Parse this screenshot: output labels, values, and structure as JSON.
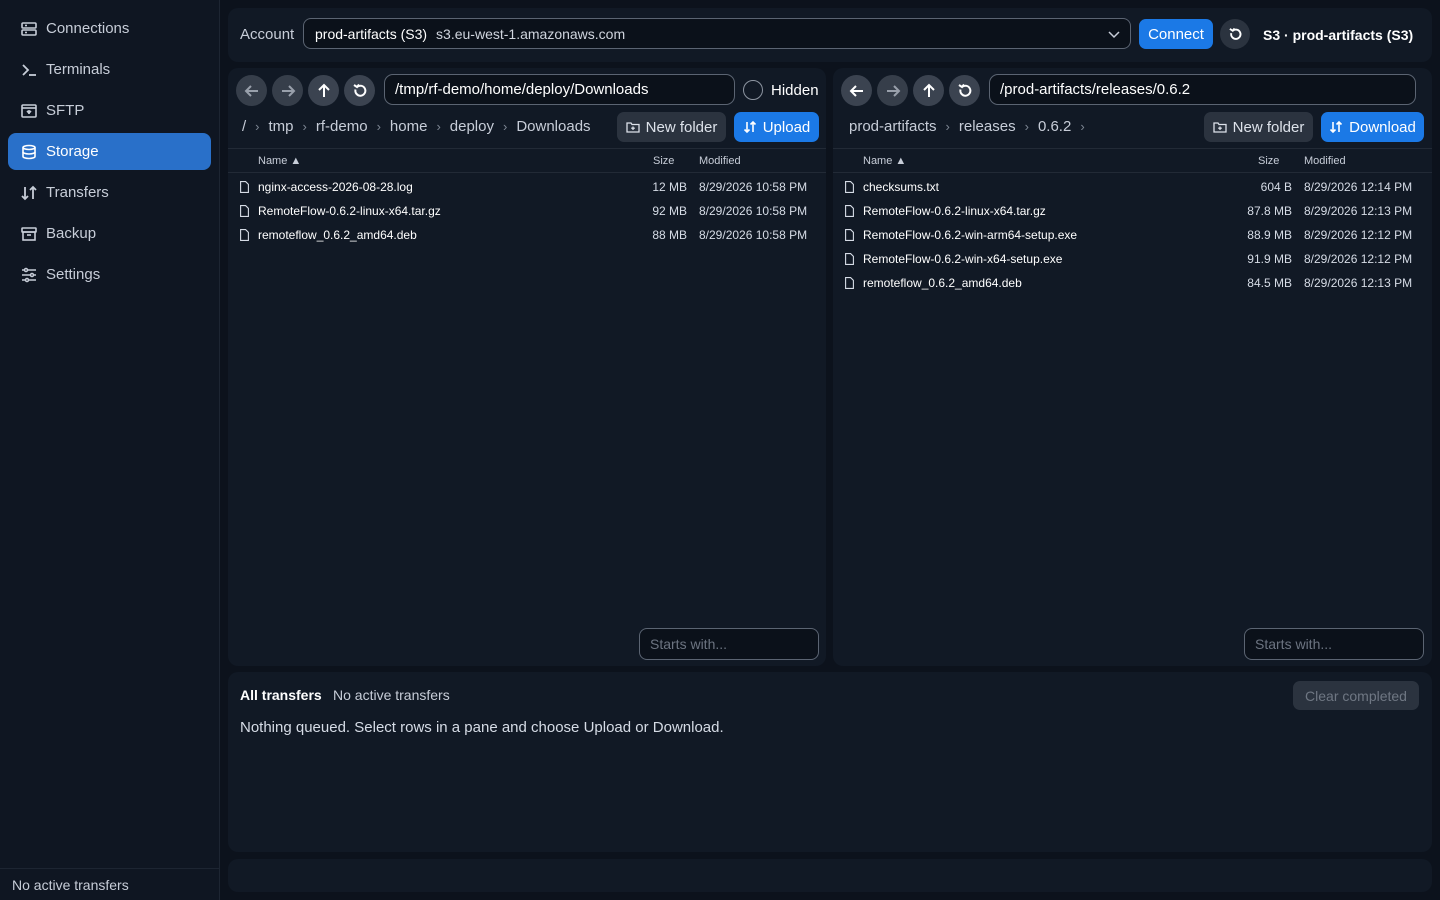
{
  "sidebar": {
    "items": [
      {
        "label": "Connections",
        "icon": "server-icon"
      },
      {
        "label": "Terminals",
        "icon": "terminal-icon"
      },
      {
        "label": "SFTP",
        "icon": "sftp-icon"
      },
      {
        "label": "Storage",
        "icon": "database-icon",
        "active": true
      },
      {
        "label": "Transfers",
        "icon": "transfer-arrows-icon"
      },
      {
        "label": "Backup",
        "icon": "archive-icon"
      },
      {
        "label": "Settings",
        "icon": "sliders-icon"
      }
    ],
    "footer": "No active transfers"
  },
  "topbar": {
    "account_label": "Account",
    "account_name": "prod-artifacts (S3)",
    "account_endpoint": "s3.eu-west-1.amazonaws.com",
    "connect_label": "Connect",
    "connection_title": "S3 · prod-artifacts (S3)"
  },
  "left_pane": {
    "path": "/tmp/rf-demo/home/deploy/Downloads",
    "hidden_label": "Hidden",
    "breadcrumbs": [
      "/",
      "tmp",
      "rf-demo",
      "home",
      "deploy",
      "Downloads"
    ],
    "new_folder_label": "New folder",
    "action_label": "Upload",
    "columns": {
      "name": "Name ▲",
      "size": "Size",
      "modified": "Modified"
    },
    "rows": [
      {
        "name": "nginx-access-2026-08-28.log",
        "size": "12 MB",
        "modified": "8/29/2026 10:58 PM"
      },
      {
        "name": "RemoteFlow-0.6.2-linux-x64.tar.gz",
        "size": "92 MB",
        "modified": "8/29/2026 10:58 PM"
      },
      {
        "name": "remoteflow_0.6.2_amd64.deb",
        "size": "88 MB",
        "modified": "8/29/2026 10:58 PM"
      }
    ],
    "filter_placeholder": "Starts with..."
  },
  "right_pane": {
    "path": "/prod-artifacts/releases/0.6.2",
    "breadcrumbs": [
      "prod-artifacts",
      "releases",
      "0.6.2"
    ],
    "new_folder_label": "New folder",
    "action_label": "Download",
    "columns": {
      "name": "Name ▲",
      "size": "Size",
      "modified": "Modified"
    },
    "rows": [
      {
        "name": "checksums.txt",
        "size": "604 B",
        "modified": "8/29/2026 12:14 PM"
      },
      {
        "name": "RemoteFlow-0.6.2-linux-x64.tar.gz",
        "size": "87.8 MB",
        "modified": "8/29/2026 12:13 PM"
      },
      {
        "name": "RemoteFlow-0.6.2-win-arm64-setup.exe",
        "size": "88.9 MB",
        "modified": "8/29/2026 12:12 PM"
      },
      {
        "name": "RemoteFlow-0.6.2-win-x64-setup.exe",
        "size": "91.9 MB",
        "modified": "8/29/2026 12:12 PM"
      },
      {
        "name": "remoteflow_0.6.2_amd64.deb",
        "size": "84.5 MB",
        "modified": "8/29/2026 12:13 PM"
      }
    ],
    "filter_placeholder": "Starts with..."
  },
  "transfers": {
    "title": "All transfers",
    "status": "No active transfers",
    "clear_label": "Clear completed",
    "empty_message": "Nothing queued. Select rows in a pane and choose Upload or Download."
  },
  "colors": {
    "accent": "#1b79e6",
    "active_nav": "#2970c9",
    "background": "#0c121c",
    "panel": "#111925"
  }
}
